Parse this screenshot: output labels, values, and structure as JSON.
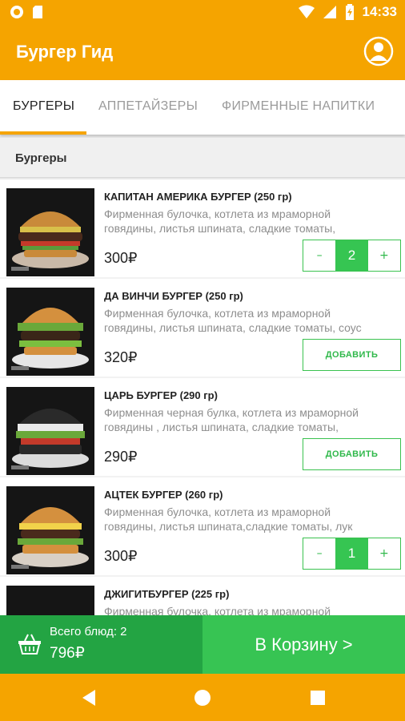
{
  "status_bar": {
    "time": "14:33"
  },
  "app": {
    "title": "Бургер Гид"
  },
  "tabs": [
    {
      "label": "БУРГЕРЫ"
    },
    {
      "label": "АППЕТАЙЗЕРЫ"
    },
    {
      "label": "ФИРМЕННЫЕ НАПИТКИ"
    }
  ],
  "section": {
    "title": "Бургеры"
  },
  "items": [
    {
      "name": "КАПИТАН АМЕРИКА БУРГЕР (250 гр)",
      "description": "Фирменная булочка, котлета из мраморной говядины, листья шпината, сладкие томаты,",
      "price": "300₽",
      "quantity": "2",
      "minus": "–",
      "plus": "+"
    },
    {
      "name": "ДА ВИНЧИ БУРГЕР (250 гр)",
      "description": "Фирменная булочка, котлета из мраморной говядины, листья шпината, сладкие томаты, соус",
      "price": "320₽",
      "add_label": "ДОБАВИТЬ"
    },
    {
      "name": "ЦАРЬ БУРГЕР (290 гр)",
      "description": "Фирменная черная булка, котлета из мраморной говядины , листья шпината, сладкие томаты,",
      "price": "290₽",
      "add_label": "ДОБАВИТЬ"
    },
    {
      "name": "АЦТЕК БУРГЕР (260 гр)",
      "description": "Фирменная булочка, котлета из мраморной говядины, листья шпината,сладкие томаты, лук",
      "price": "300₽",
      "quantity": "1",
      "minus": "–",
      "plus": "+"
    },
    {
      "name": "ДЖИГИТБУРГЕР (225 гр)",
      "description": "Фирменная булочка, котлета из мраморной",
      "price": ""
    }
  ],
  "cart": {
    "count_label": "Всего блюд: 2",
    "total": "796₽",
    "button_label": "В Корзину >"
  },
  "icons": {
    "account": "account-circle-icon",
    "basket": "basket-icon",
    "back": "back-triangle-icon",
    "home": "home-circle-icon",
    "recents": "recents-square-icon"
  },
  "colors": {
    "primary": "#f5a400",
    "accent_green": "#37c453",
    "dark_green": "#23a443"
  }
}
